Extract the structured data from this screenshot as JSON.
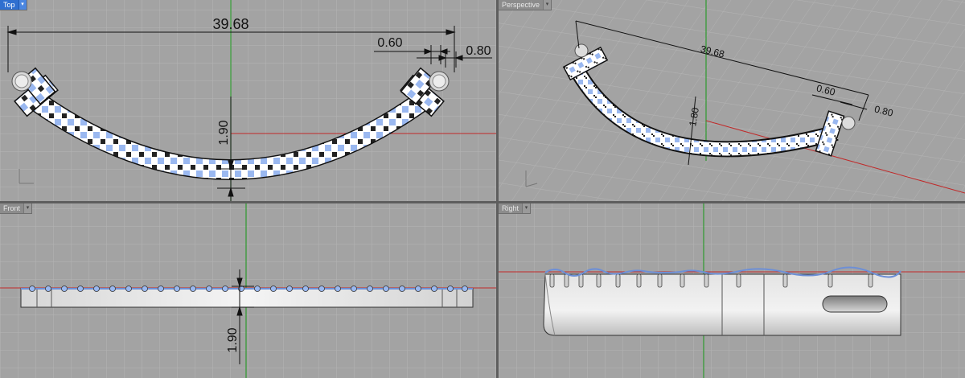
{
  "viewports": {
    "top": {
      "label": "Top",
      "dropdown": "▾"
    },
    "perspective": {
      "label": "Perspective",
      "dropdown": "▾"
    },
    "front": {
      "label": "Front",
      "dropdown": "▾"
    },
    "right": {
      "label": "Right",
      "dropdown": "▾"
    }
  },
  "dimensions": {
    "overall_width": "39.68",
    "gap": "0.60",
    "tab_width": "0.80",
    "height": "1.90",
    "persp_width": "39.68",
    "persp_gap": "0.60",
    "persp_tab": "0.80",
    "persp_height": "1.80",
    "front_height": "1.90"
  },
  "colors": {
    "viewport_bg": "#a3a3a3",
    "grid": "#b3b3b3",
    "active_tab": "#2f6fd0",
    "led": "#9ab8f0",
    "y_axis": "#2f9a2f",
    "x_axis": "#c02a2a"
  }
}
